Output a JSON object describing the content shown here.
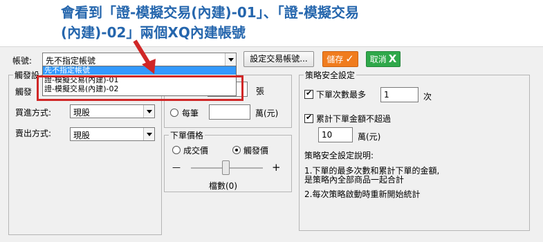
{
  "headline": {
    "line1": "會看到「證-模擬交易(內建)-01」、「證-模擬交易",
    "line2": "(內建)-02」兩個XQ內建帳號"
  },
  "account": {
    "label": "帳號:",
    "selected": "先不指定帳號",
    "options": [
      "先不指定帳號",
      "證-模擬交易(內建)-01",
      "證-模擬交易(內建)-02"
    ]
  },
  "toolbar": {
    "set_account_label": "設定交易帳號...",
    "save_label": "儲存",
    "save_glyph": "✓",
    "cancel_label": "取消",
    "cancel_glyph": "X"
  },
  "trigger": {
    "group_title": "觸發設",
    "trigger_label": "觸發",
    "buy_label": "買進方式:",
    "buy_value": "現股",
    "sell_label": "賣出方式:",
    "sell_value": "現股"
  },
  "quantity": {
    "unit_shares": "張",
    "per_trade_label": "每筆",
    "unit_amount": "萬(元)"
  },
  "order_price": {
    "title": "下單價格",
    "option_filled": "成交價",
    "option_trigger": "觸發價",
    "minus": "—",
    "plus": "+",
    "ticks_label": "檔數(0)"
  },
  "safety": {
    "title": "策略安全設定",
    "max_orders_label": "下單次數最多",
    "max_orders_value": "1",
    "max_orders_unit": "次",
    "total_amount_label": "累計下單金額不超過",
    "total_amount_value": "10",
    "total_amount_unit": "萬(元)",
    "desc_title": "策略安全設定說明:",
    "desc_1a": "1.下單的最多次數和累計下單的金額,",
    "desc_1b": "是策略內全部商品一起合計",
    "desc_2": "2.每次策略啟動時重新開始統計"
  },
  "colors": {
    "headline": "#2566ad",
    "save": "#f07c1e",
    "cancel": "#2fa84a",
    "highlight_box": "#d02727",
    "selection": "#3399ff",
    "arrow": "#d02727"
  }
}
